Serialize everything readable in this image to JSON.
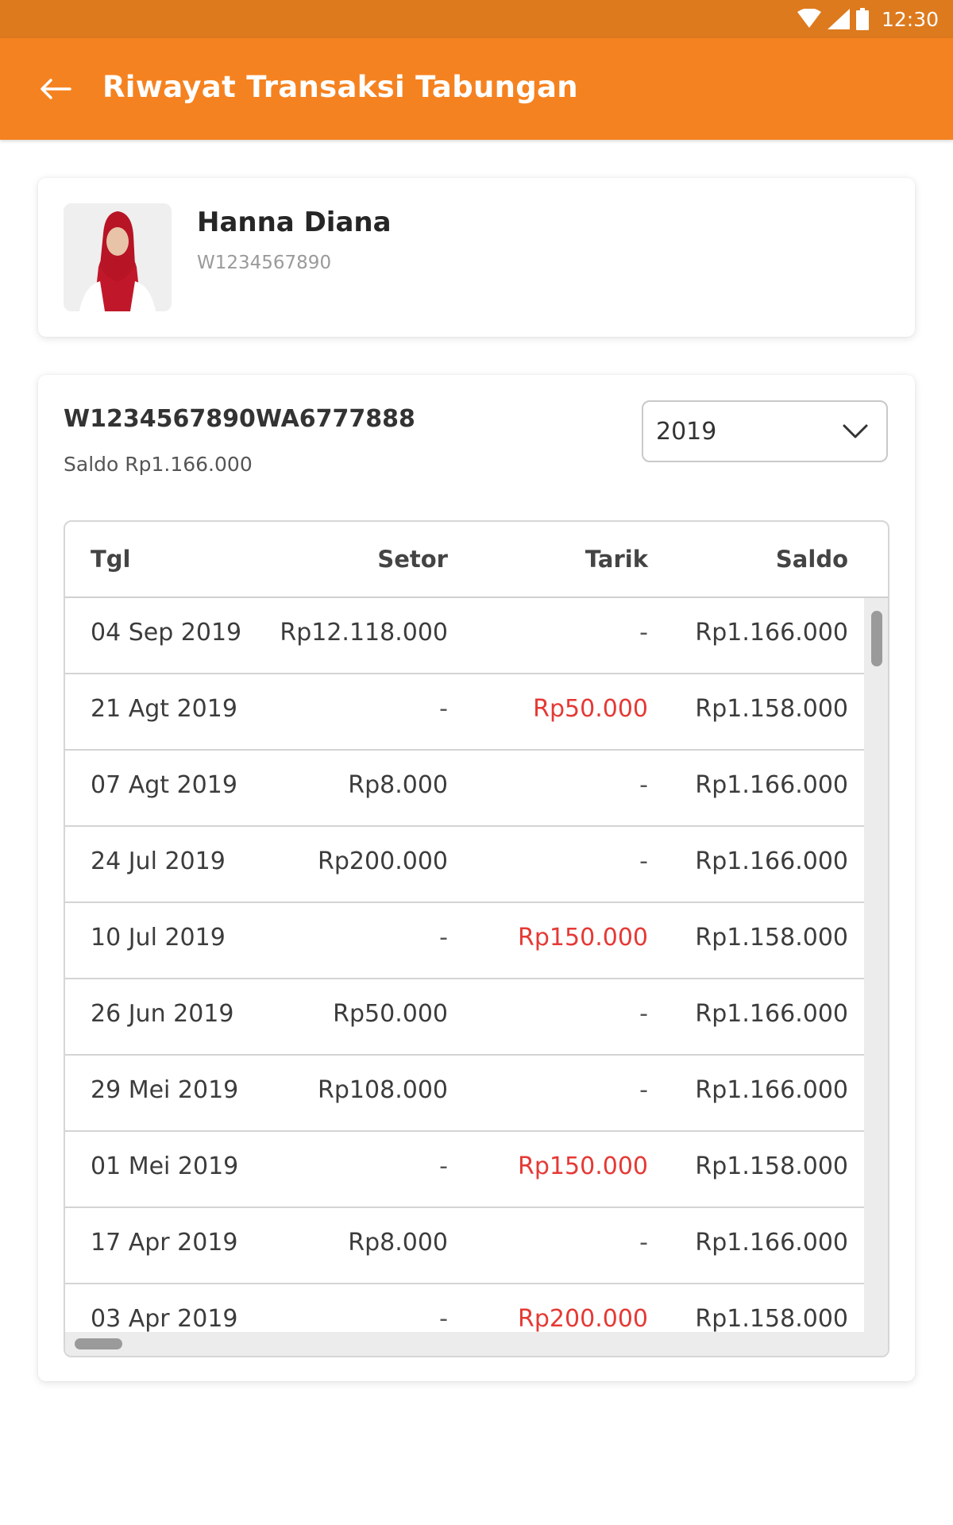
{
  "status_bar": {
    "time": "12:30",
    "icons": [
      "wifi-icon",
      "signal-icon",
      "battery-icon"
    ]
  },
  "app_bar": {
    "title": "Riwayat Transaksi Tabungan",
    "back_icon": "arrow-left-icon"
  },
  "profile": {
    "name": "Hanna Diana",
    "id": "W1234567890"
  },
  "account": {
    "number": "W1234567890WA6777888",
    "balance": "Saldo Rp1.166.000",
    "year_select": {
      "value": "2019"
    }
  },
  "table": {
    "headers": {
      "date": "Tgl",
      "setor": "Setor",
      "tarik": "Tarik",
      "saldo": "Saldo"
    },
    "rows": [
      {
        "date": "04 Sep 2019",
        "setor": "Rp12.118.000",
        "tarik": "-",
        "saldo": "Rp1.166.000"
      },
      {
        "date": "21 Agt 2019",
        "setor": "-",
        "tarik": "Rp50.000",
        "saldo": "Rp1.158.000"
      },
      {
        "date": "07 Agt 2019",
        "setor": "Rp8.000",
        "tarik": "-",
        "saldo": "Rp1.166.000"
      },
      {
        "date": "24 Jul 2019",
        "setor": "Rp200.000",
        "tarik": "-",
        "saldo": "Rp1.166.000"
      },
      {
        "date": "10 Jul 2019",
        "setor": "-",
        "tarik": "Rp150.000",
        "saldo": "Rp1.158.000"
      },
      {
        "date": "26 Jun 2019",
        "setor": "Rp50.000",
        "tarik": "-",
        "saldo": "Rp1.166.000"
      },
      {
        "date": "29 Mei 2019",
        "setor": "Rp108.000",
        "tarik": "-",
        "saldo": "Rp1.166.000"
      },
      {
        "date": "01 Mei 2019",
        "setor": "-",
        "tarik": "Rp150.000",
        "saldo": "Rp1.158.000"
      },
      {
        "date": "17 Apr 2019",
        "setor": "Rp8.000",
        "tarik": "-",
        "saldo": "Rp1.166.000"
      },
      {
        "date": "03 Apr 2019",
        "setor": "-",
        "tarik": "Rp200.000",
        "saldo": "Rp1.158.000"
      }
    ]
  },
  "colors": {
    "primary": "#F58220",
    "status_bar": "#DD7A1E",
    "withdrawal": "#E53935"
  }
}
